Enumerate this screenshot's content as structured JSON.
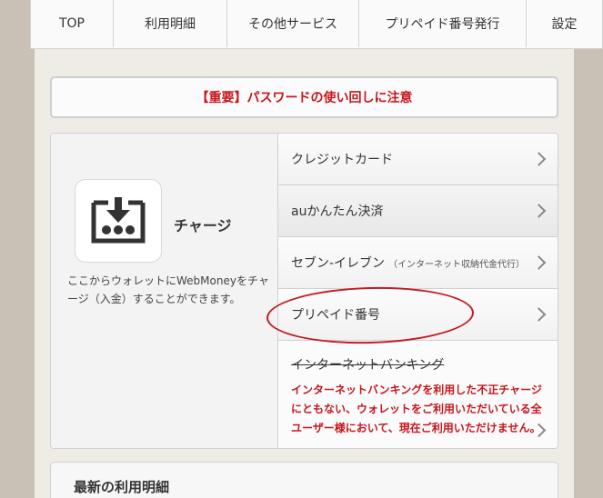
{
  "nav": [
    {
      "label": "TOP"
    },
    {
      "label": "利用明細"
    },
    {
      "label": "その他サービス"
    },
    {
      "label": "プリペイド番号発行"
    },
    {
      "label": "設定"
    }
  ],
  "notice": {
    "text": "【重要】パスワードの使い回しに注意"
  },
  "charge": {
    "title": "チャージ",
    "description": "ここからウォレットにWebMoneyをチャージ（入金）することができます。",
    "icon": "download-charge-icon"
  },
  "menu": {
    "credit": "クレジットカード",
    "au": "auかんたん決済",
    "seven": "セブン-イレブン",
    "seven_note": "（インターネット収納代金代行）",
    "prepaid": "プリペイド番号",
    "netbank": "インターネットバンキング",
    "netbank_warning": "インターネットバンキングを利用した不正チャージにともない、ウォレットをご利用いただいている全ユーザー様において、現在ご利用いただけません。"
  },
  "latest": {
    "title": "最新の利用明細"
  },
  "colors": {
    "accent_red": "#c8161d",
    "annotation_red": "#c31b24"
  }
}
